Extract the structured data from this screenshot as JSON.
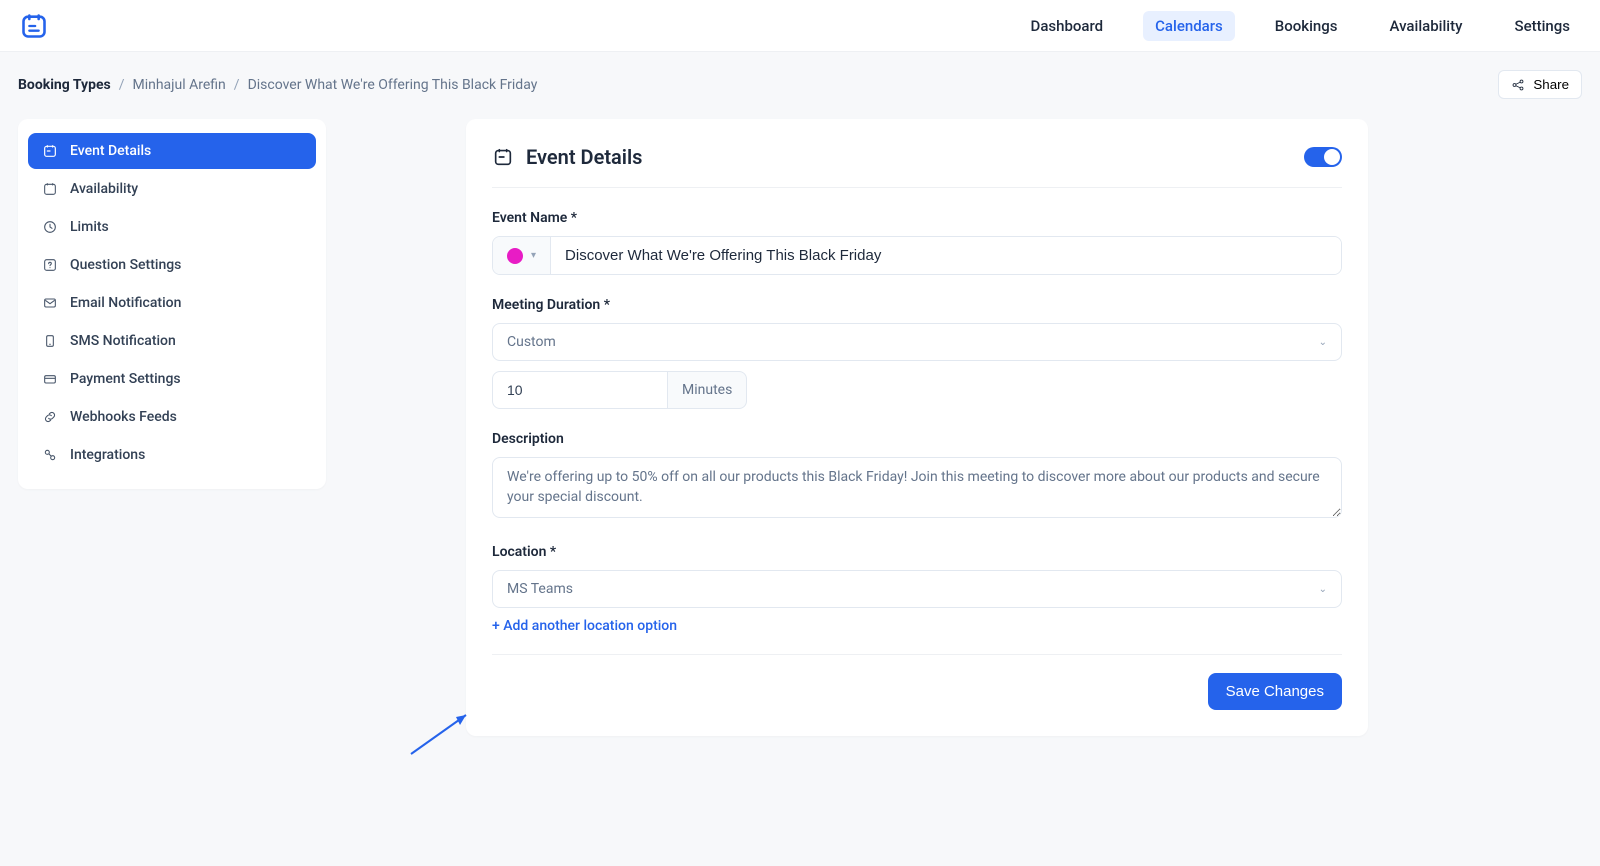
{
  "nav": {
    "items": [
      "Dashboard",
      "Calendars",
      "Bookings",
      "Availability",
      "Settings"
    ],
    "activeIndex": 1
  },
  "breadcrumb": {
    "root": "Booking Types",
    "mid": "Minhajul Arefin",
    "leaf": "Discover What We're Offering This Black Friday"
  },
  "share_label": "Share",
  "sidebar": {
    "items": [
      {
        "label": "Event Details"
      },
      {
        "label": "Availability"
      },
      {
        "label": "Limits"
      },
      {
        "label": "Question Settings"
      },
      {
        "label": "Email Notification"
      },
      {
        "label": "SMS Notification"
      },
      {
        "label": "Payment Settings"
      },
      {
        "label": "Webhooks Feeds"
      },
      {
        "label": "Integrations"
      }
    ],
    "activeIndex": 0
  },
  "card": {
    "title": "Event Details",
    "event_name_label": "Event Name *",
    "event_name_value": "Discover What We're Offering This Black Friday",
    "event_color": "#e81cc5",
    "duration_label": "Meeting Duration *",
    "duration_preset": "Custom",
    "duration_value": "10",
    "duration_unit": "Minutes",
    "description_label": "Description",
    "description_value": "We're offering up to 50% off on all our products this Black Friday! Join this meeting to discover more about our products and secure your special discount.",
    "location_label": "Location *",
    "location_value": "MS Teams",
    "add_location_label": "+ Add another location option",
    "save_label": "Save Changes"
  }
}
